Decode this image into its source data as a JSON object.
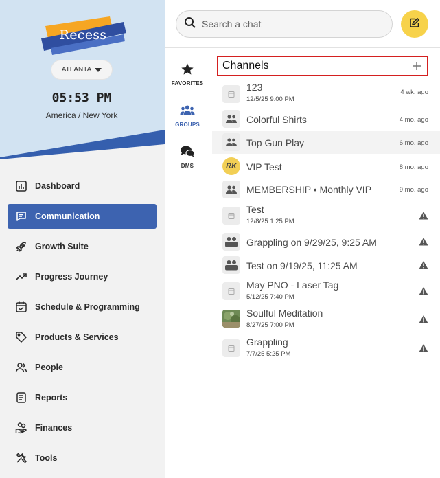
{
  "brand": {
    "name": "Recess"
  },
  "location": {
    "label": "ATLANTA"
  },
  "clock": {
    "time": "05:53 PM",
    "timezone": "America / New York"
  },
  "nav": {
    "items": [
      {
        "label": "Dashboard",
        "icon": "bar-chart-icon"
      },
      {
        "label": "Communication",
        "icon": "chat-icon",
        "active": true
      },
      {
        "label": "Growth Suite",
        "icon": "rocket-icon"
      },
      {
        "label": "Progress Journey",
        "icon": "trend-up-icon"
      },
      {
        "label": "Schedule & Programming",
        "icon": "calendar-icon"
      },
      {
        "label": "Products & Services",
        "icon": "tag-icon"
      },
      {
        "label": "People",
        "icon": "people-icon"
      },
      {
        "label": "Reports",
        "icon": "document-icon"
      },
      {
        "label": "Finances",
        "icon": "hand-coins-icon"
      },
      {
        "label": "Tools",
        "icon": "tools-icon"
      }
    ]
  },
  "search": {
    "placeholder": "Search a chat"
  },
  "categories": [
    {
      "label": "FAVORITES",
      "icon": "star-icon"
    },
    {
      "label": "GROUPS",
      "icon": "group-icon",
      "active": true
    },
    {
      "label": "DMS",
      "icon": "speech-bubbles-icon"
    }
  ],
  "channels": {
    "title": "Channels",
    "add_label": "+",
    "items": [
      {
        "title": "123",
        "subtitle": "12/5/25 9:00 PM",
        "time": "4 wk. ago",
        "avatar": "event-icon"
      },
      {
        "title": "Colorful Shirts",
        "subtitle": "",
        "time": "4 mo. ago",
        "avatar": "group-icon"
      },
      {
        "title": "Top Gun Play",
        "subtitle": "",
        "time": "6 mo. ago",
        "avatar": "group-icon"
      },
      {
        "title": "VIP Test",
        "subtitle": "",
        "time": "8 mo. ago",
        "avatar": "initials",
        "initials": "RK"
      },
      {
        "title": "MEMBERSHIP • Monthly VIP",
        "subtitle": "",
        "time": "9 mo. ago",
        "avatar": "group-icon"
      },
      {
        "title": "Test",
        "subtitle": "12/8/25 1:25 PM",
        "time": "",
        "avatar": "event-icon",
        "warning": true
      },
      {
        "title": "Grappling on 9/29/25, 9:25 AM",
        "subtitle": "",
        "time": "",
        "avatar": "people-icon",
        "warning": true
      },
      {
        "title": "Test on 9/19/25, 11:25 AM",
        "subtitle": "",
        "time": "",
        "avatar": "people-icon",
        "warning": true
      },
      {
        "title": "May PNO - Laser Tag",
        "subtitle": "5/12/25 7:40 PM",
        "time": "",
        "avatar": "event-icon",
        "warning": true
      },
      {
        "title": "Soulful Meditation",
        "subtitle": "8/27/25 7:00 PM",
        "time": "",
        "avatar": "photo-thumbnail",
        "warning": true
      },
      {
        "title": "Grappling",
        "subtitle": "7/7/25 5:25 PM",
        "time": "",
        "avatar": "event-icon",
        "warning": true
      }
    ]
  },
  "colors": {
    "accent": "#3d63b0",
    "compose": "#f7d24a",
    "highlight": "#d42020"
  }
}
